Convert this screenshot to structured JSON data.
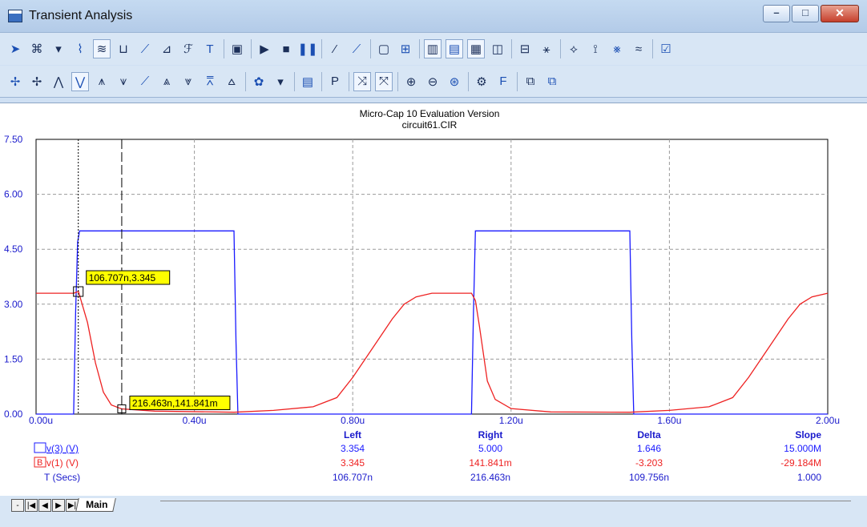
{
  "window": {
    "title": "Transient Analysis",
    "minimize_glyph": "–",
    "maximize_glyph": "□",
    "close_glyph": "✕"
  },
  "toolbar1": [
    {
      "name": "select-arrow-icon",
      "glyph": "➤"
    },
    {
      "name": "component-mode-icon",
      "glyph": "⌘"
    },
    {
      "name": "dropdown-arrow-icon",
      "glyph": "▾"
    },
    {
      "name": "wire-mode-icon",
      "glyph": "⌇"
    },
    {
      "name": "add-curve-icon",
      "glyph": "≋",
      "pressed": true
    },
    {
      "name": "scale-mode-icon",
      "glyph": "⊔"
    },
    {
      "name": "xy-mode-icon",
      "glyph": "⟋"
    },
    {
      "name": "node-mode-icon",
      "glyph": "⊿"
    },
    {
      "name": "fo-mode-icon",
      "glyph": "ℱ"
    },
    {
      "name": "text-mode-icon",
      "glyph": "T"
    },
    {
      "sep": true
    },
    {
      "name": "properties-icon",
      "glyph": "▣"
    },
    {
      "sep": true
    },
    {
      "name": "run-icon",
      "glyph": "▶"
    },
    {
      "name": "stop-icon",
      "glyph": "■"
    },
    {
      "name": "pause-icon",
      "glyph": "❚❚"
    },
    {
      "sep": true
    },
    {
      "name": "line-icon",
      "glyph": "⁄"
    },
    {
      "name": "diagonal-line-icon",
      "glyph": "⟋"
    },
    {
      "sep": true
    },
    {
      "name": "rectangle-icon",
      "glyph": "▢"
    },
    {
      "name": "grid-icon",
      "glyph": "⊞"
    },
    {
      "sep": true
    },
    {
      "name": "vertical-grid-icon",
      "glyph": "▥",
      "pressed": true
    },
    {
      "name": "horizontal-grid-icon",
      "glyph": "▤",
      "pressed": true
    },
    {
      "name": "minor-grid-icon",
      "glyph": "▦",
      "pressed": true
    },
    {
      "name": "border-icon",
      "glyph": "◫"
    },
    {
      "sep": true
    },
    {
      "name": "baseline-icon",
      "glyph": "⊟"
    },
    {
      "name": "cursor-line-icon",
      "glyph": "⚹"
    },
    {
      "sep": true
    },
    {
      "name": "peak-icon",
      "glyph": "⟡"
    },
    {
      "name": "valley-icon",
      "glyph": "⟟"
    },
    {
      "name": "value-icon",
      "glyph": "⨳"
    },
    {
      "name": "tangent-icon",
      "glyph": "≈"
    },
    {
      "sep": true
    },
    {
      "name": "chart-options-icon",
      "glyph": "☑"
    }
  ],
  "toolbar2": [
    {
      "name": "next-point-icon",
      "glyph": "✢"
    },
    {
      "name": "prev-point-icon",
      "glyph": "✢"
    },
    {
      "name": "peak-search-icon",
      "glyph": "⋀"
    },
    {
      "name": "valley-search-icon",
      "glyph": "⋁",
      "pressed": true
    },
    {
      "name": "high-search-icon",
      "glyph": "⩚"
    },
    {
      "name": "low-search-icon",
      "glyph": "⩛"
    },
    {
      "name": "inflection-icon",
      "glyph": "⟋"
    },
    {
      "name": "global-high-icon",
      "glyph": "⩓"
    },
    {
      "name": "global-low-icon",
      "glyph": "⩔"
    },
    {
      "name": "top-icon",
      "glyph": "⩞"
    },
    {
      "name": "bottom-icon",
      "glyph": "⩟"
    },
    {
      "sep": true
    },
    {
      "name": "palette-icon",
      "glyph": "✿"
    },
    {
      "name": "dropdown-arrow-2-icon",
      "glyph": "▾"
    },
    {
      "sep": true
    },
    {
      "name": "table-icon",
      "glyph": "▤"
    },
    {
      "sep": true
    },
    {
      "name": "plot-p-icon",
      "glyph": "P"
    },
    {
      "sep": true
    },
    {
      "name": "x-scale-icon",
      "glyph": "⤨",
      "pressed": true
    },
    {
      "name": "y-scale-icon",
      "glyph": "⤧",
      "pressed": true
    },
    {
      "sep": true
    },
    {
      "name": "zoom-in-icon",
      "glyph": "⊕"
    },
    {
      "name": "zoom-out-icon",
      "glyph": "⊖"
    },
    {
      "name": "zoom-fit-icon",
      "glyph": "⊛"
    },
    {
      "sep": true
    },
    {
      "name": "settings-icon",
      "glyph": "⚙"
    },
    {
      "name": "font-icon",
      "glyph": "F"
    },
    {
      "sep": true
    },
    {
      "name": "copy-icon",
      "glyph": "⧉"
    },
    {
      "name": "paste-icon",
      "glyph": "⧉"
    }
  ],
  "plot": {
    "header_line1": "Micro-Cap 10 Evaluation Version",
    "header_line2": "circuit61.CIR",
    "y_ticks": [
      "0.00",
      "1.50",
      "3.00",
      "4.50",
      "6.00",
      "7.50"
    ],
    "x_ticks": [
      "0.00u",
      "0.40u",
      "0.80u",
      "1.20u",
      "1.60u",
      "2.00u"
    ],
    "x_unit": "u",
    "left_cursor_label": "106.707n,3.345",
    "right_cursor_label": "216.463n,141.841m"
  },
  "colors": {
    "series_blue": "#1a1aff",
    "series_red": "#ee2222",
    "axis_label_blue": "#1a1acc",
    "cursor_label_bg": "#ffff00",
    "grid": "#9a9a9a"
  },
  "chart_data": {
    "type": "line",
    "xlim": [
      0,
      2.0
    ],
    "ylim": [
      0,
      7.5
    ],
    "grid": true,
    "series": [
      {
        "name": "v(3) (V)",
        "color": "#1a1aff",
        "x": [
          0,
          0.095,
          0.1,
          0.105,
          0.11,
          0.5,
          0.505,
          0.51,
          1.1,
          1.105,
          1.11,
          1.5,
          1.505,
          1.51,
          2.0
        ],
        "y": [
          0,
          0,
          2.8,
          4.7,
          5.0,
          5.0,
          2.0,
          0,
          0,
          2.8,
          5.0,
          5.0,
          2.0,
          0,
          0
        ]
      },
      {
        "name": "v(1) (V)",
        "color": "#ee2222",
        "x": [
          0,
          0.095,
          0.107,
          0.13,
          0.15,
          0.17,
          0.19,
          0.216,
          0.3,
          0.5,
          0.6,
          0.7,
          0.76,
          0.8,
          0.85,
          0.9,
          0.93,
          0.96,
          1.0,
          1.1,
          1.11,
          1.12,
          1.14,
          1.16,
          1.2,
          1.3,
          1.5,
          1.6,
          1.7,
          1.76,
          1.8,
          1.85,
          1.9,
          1.93,
          1.96,
          2.0
        ],
        "y": [
          3.3,
          3.3,
          3.345,
          2.5,
          1.4,
          0.6,
          0.25,
          0.142,
          0.08,
          0.05,
          0.1,
          0.2,
          0.45,
          1.0,
          1.8,
          2.6,
          3.0,
          3.2,
          3.3,
          3.3,
          3.1,
          2.4,
          0.9,
          0.4,
          0.15,
          0.06,
          0.05,
          0.1,
          0.2,
          0.45,
          1.0,
          1.8,
          2.6,
          3.0,
          3.2,
          3.3
        ]
      }
    ],
    "cursors": {
      "left": {
        "x": 0.106707,
        "y": 3.345
      },
      "right": {
        "x": 0.216463,
        "y": 0.141841
      }
    }
  },
  "readout": {
    "headers": [
      "Left",
      "Right",
      "Delta",
      "Slope"
    ],
    "rows": [
      {
        "label": "v(3) (V)",
        "color": "#1a1aff",
        "values": [
          "3.354",
          "5.000",
          "1.646",
          "15.000M"
        ]
      },
      {
        "label": "v(1) (V)",
        "color": "#ee2222",
        "values": [
          "3.345",
          "141.841m",
          "-3.203",
          "-29.184M"
        ]
      },
      {
        "label": "T (Secs)",
        "color": "#1a1acc",
        "values": [
          "106.707n",
          "216.463n",
          "109.756n",
          "1.000"
        ]
      }
    ],
    "legend_box_b": "B"
  },
  "tabs": {
    "main_label": "Main",
    "nav": [
      "-",
      "|◀",
      "◀",
      "▶",
      "▶|"
    ]
  }
}
